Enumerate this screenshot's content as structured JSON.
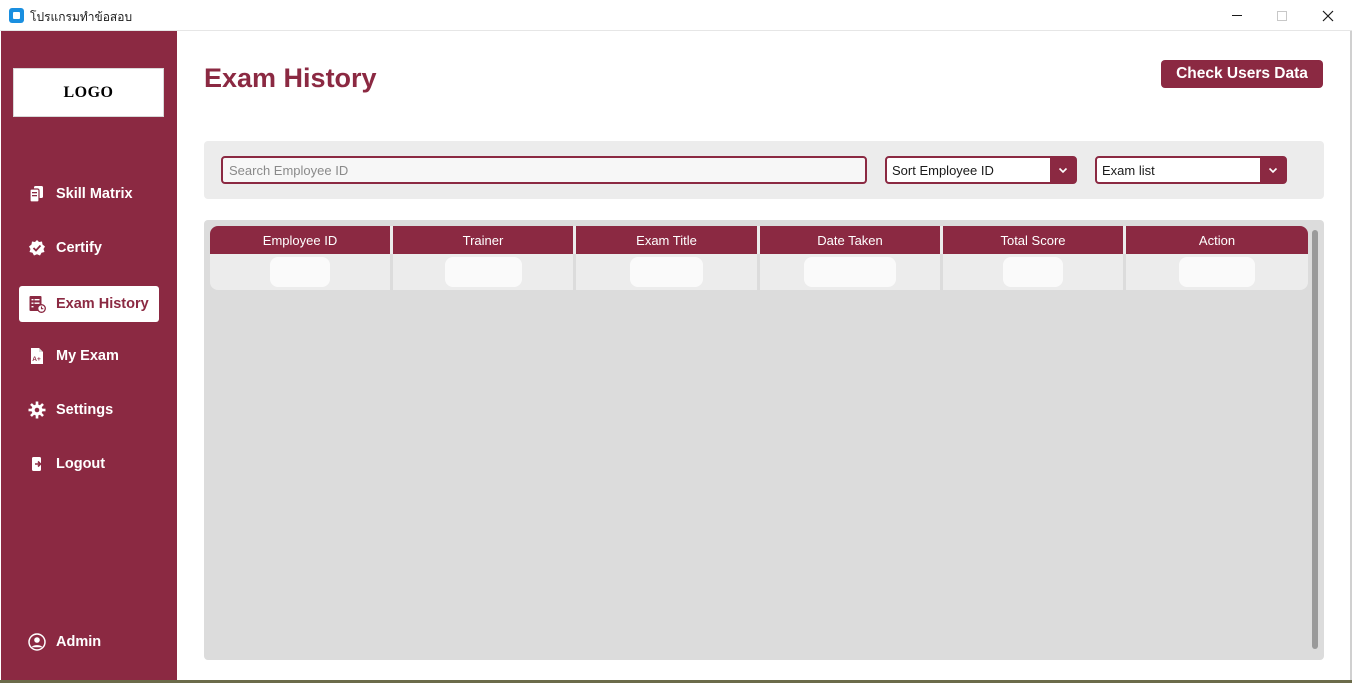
{
  "window": {
    "title": "โปรแกรมทำข้อสอบ"
  },
  "sidebar": {
    "logo": "LOGO",
    "items": [
      {
        "label": "Skill Matrix",
        "icon": "cards-icon"
      },
      {
        "label": "Certify",
        "icon": "badge-check-icon"
      },
      {
        "label": "Exam History",
        "icon": "history-list-icon",
        "active": true
      },
      {
        "label": "My Exam",
        "icon": "grade-document-icon"
      },
      {
        "label": "Settings",
        "icon": "gear-icon"
      },
      {
        "label": "Logout",
        "icon": "logout-icon"
      }
    ],
    "user": {
      "label": "Admin",
      "icon": "user-circle-icon"
    }
  },
  "header": {
    "title": "Exam History",
    "check_users_label": "Check Users Data"
  },
  "filters": {
    "search_placeholder": "Search Employee ID",
    "sort_value": "Sort Employee ID",
    "exam_value": "Exam list"
  },
  "table": {
    "columns": [
      "Employee ID",
      "Trainer",
      "Exam Title",
      "Date Taken",
      "Total Score",
      "Action"
    ]
  },
  "colors": {
    "brand": "#8b2942",
    "panel": "#dcdcdc",
    "filter_bg": "#ececec"
  }
}
